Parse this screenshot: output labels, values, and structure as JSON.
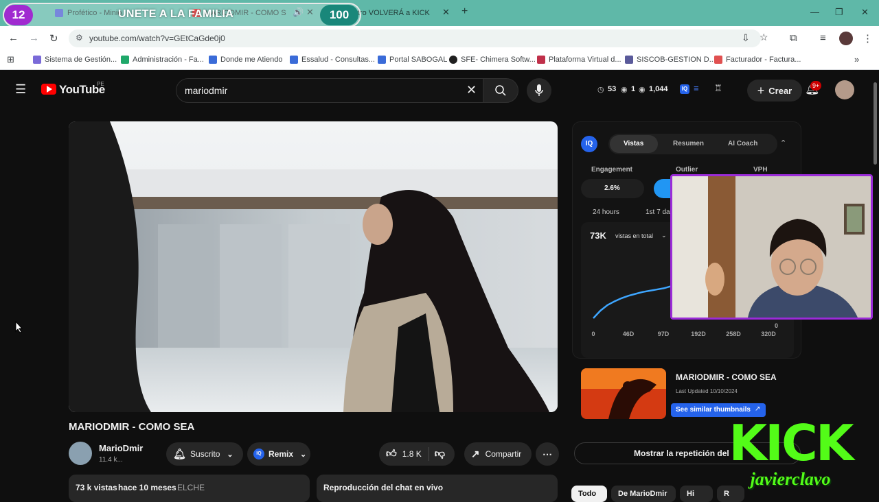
{
  "browser": {
    "tabs": [
      {
        "label": "Profético - Minio"
      },
      {
        "label": "MARIODMIR - COMO S"
      },
      {
        "label": "¿Neutro VOLVERÁ a KICK"
      }
    ],
    "overlay": {
      "left_count": "12",
      "title": "UNETE A LA FAMILIA",
      "right_count": "100"
    },
    "url": "youtube.com/watch?v=GEtCaGde0j0",
    "bookmarks": [
      {
        "label": "Sistema de Gestión..."
      },
      {
        "label": "Administración - Fa..."
      },
      {
        "label": "Donde me Atiendo"
      },
      {
        "label": "Essalud - Consultas..."
      },
      {
        "label": "Portal SABOGAL"
      },
      {
        "label": "SFE- Chimera Softw..."
      },
      {
        "label": "Plataforma Virtual d..."
      },
      {
        "label": "SISCOB-GESTION D..."
      },
      {
        "label": "Facturador - Factura..."
      }
    ]
  },
  "youtube": {
    "logo": "YouTube",
    "country": "PE",
    "search_value": "mariodmir",
    "stats": {
      "watch": "53",
      "eye_small": "1",
      "views": "1,044"
    },
    "create_label": "Crear",
    "notif_badge": "9+"
  },
  "video": {
    "title": "MARIODMIR - COMO SEA",
    "channel": "MarioDmir",
    "subs": "11.4 k...",
    "subscribed_label": "Suscrito",
    "remix_label": "Remix",
    "likes": "1.8 K",
    "share_label": "Compartir",
    "meta_views": "73 k vistas",
    "meta_age": "hace 10 meses",
    "meta_tag": "ELCHE",
    "chat_replay": "Reproducción del chat en vivo"
  },
  "iq_panel": {
    "tabs": [
      "Vistas",
      "Resumen",
      "AI Coach"
    ],
    "active_tab": "Vistas",
    "metrics": {
      "engagement_label": "Engagement",
      "engagement_value": "2.6%",
      "outlier_label": "Outlier",
      "vph_label": "VPH"
    },
    "range_tabs": [
      "24 hours",
      "1st 7 da"
    ],
    "total_views": "73K",
    "total_dropdown": "vistas en total",
    "chart_data": {
      "type": "line",
      "title": "",
      "x_ticks": [
        "0",
        "46D",
        "97D",
        "192D",
        "258D",
        "320D"
      ],
      "y_ticks": [
        "0"
      ],
      "series": [
        {
          "x": [
            0,
            10,
            20,
            30,
            40,
            50,
            60,
            70,
            80,
            90,
            100,
            110
          ],
          "y": [
            0,
            12,
            21,
            27,
            32,
            36,
            39,
            42,
            44,
            46,
            48,
            51
          ]
        }
      ],
      "color": "#3ea6ff"
    },
    "thumb_card": {
      "title": "MARIODMIR - COMO SEA",
      "updated": "Last Updated 10/10/2024",
      "similar_btn": "See similar thumbnails"
    }
  },
  "replay_btn": "Mostrar la repetición del",
  "bottom_chips": [
    "Todo",
    "De MarioDmir",
    "Hi",
    "R"
  ],
  "stream_overlay": {
    "brand": "KICK",
    "handle": "javierclavo",
    "color": "#53fc18"
  }
}
